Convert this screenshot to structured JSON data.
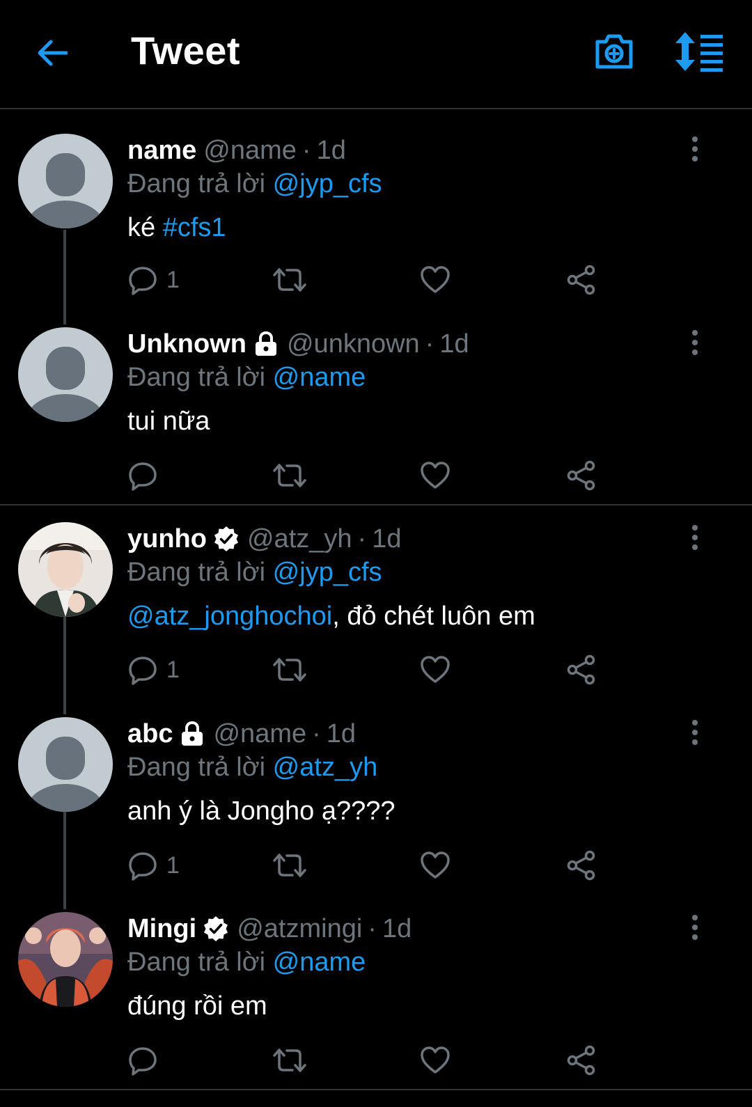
{
  "header": {
    "title": "Tweet",
    "back_icon": "arrow-left-icon",
    "camera_icon": "camera-plus-icon",
    "sort_icon": "sort-list-icon"
  },
  "colors": {
    "background": "#000000",
    "accent": "#1d9bf0",
    "secondary_text": "#6e767d",
    "divider": "#2f3336"
  },
  "reply_prefix": "Đang trả lời",
  "tweets": [
    {
      "name": "name",
      "handle": "@name",
      "dot": "·",
      "time": "1d",
      "reply_to": "@jyp_cfs",
      "text": "ké ",
      "hashtag": "#cfs1",
      "reply_count": "1",
      "badge": null
    },
    {
      "name": "Unknown",
      "handle": "@unknown",
      "dot": "·",
      "time": "1d",
      "reply_to": "@name",
      "text": "tui nữa",
      "reply_count": "",
      "badge": "lock-icon"
    },
    {
      "name": "yunho",
      "handle": "@atz_yh",
      "dot": "·",
      "time": "1d",
      "reply_to": "@jyp_cfs",
      "text_mention": "@atz_jonghochoi",
      "text": ", đỏ chét luôn em",
      "reply_count": "1",
      "badge": "verified-icon"
    },
    {
      "name": "abc",
      "handle": "@name",
      "dot": "·",
      "time": "1d",
      "reply_to": "@atz_yh",
      "text": "anh ý là Jongho ạ????",
      "reply_count": "1",
      "badge": "lock-icon"
    },
    {
      "name": "Mingi",
      "handle": "@atzmingi",
      "dot": "·",
      "time": "1d",
      "reply_to": "@name",
      "text": "đúng rồi em",
      "reply_count": "",
      "badge": "verified-icon"
    }
  ]
}
